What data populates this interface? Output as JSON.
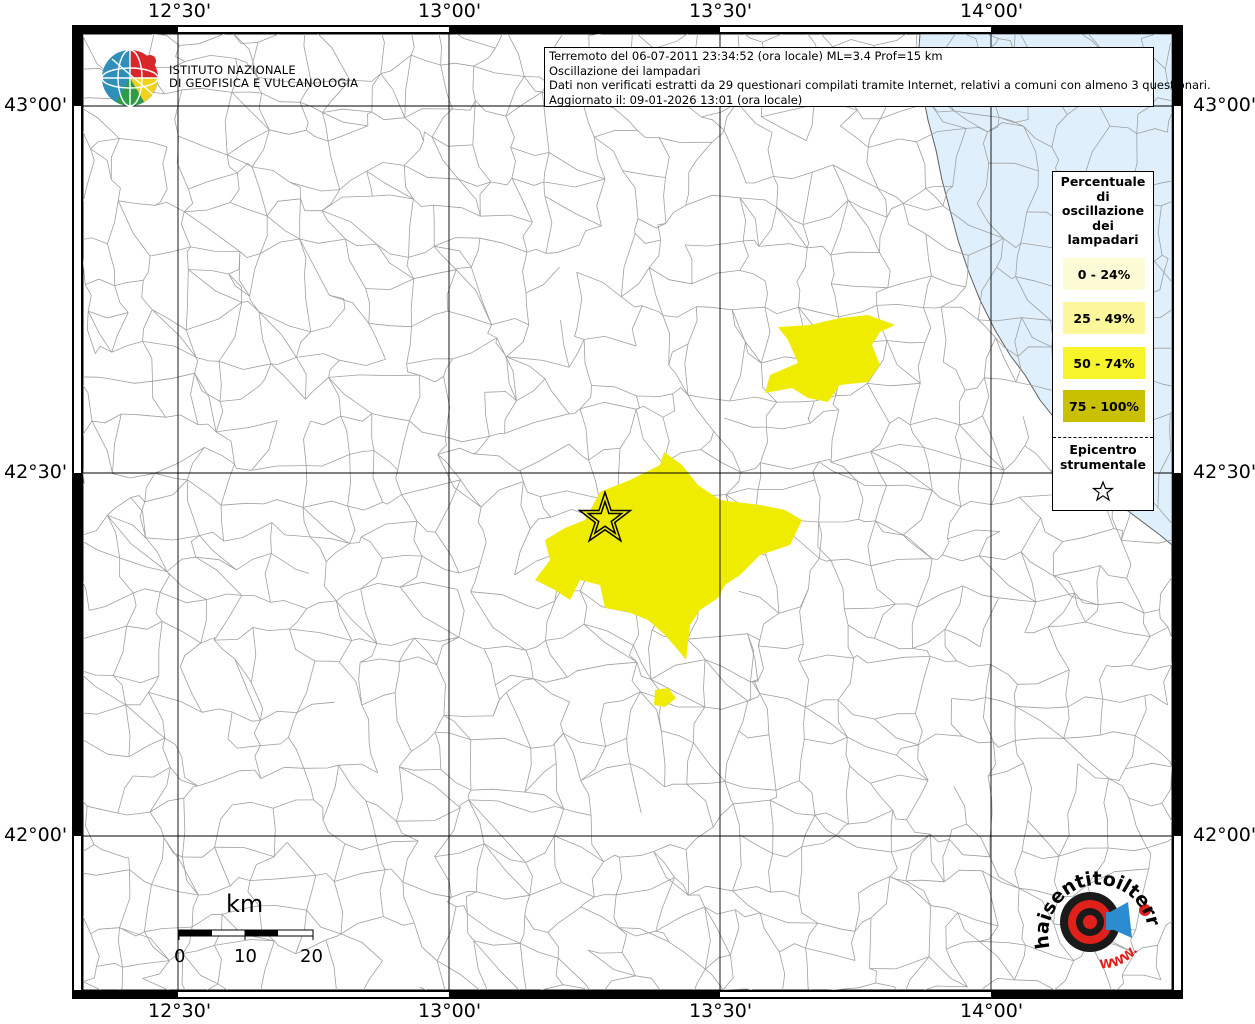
{
  "axes": {
    "top": [
      "12°30'",
      "13°00'",
      "13°30'",
      "14°00'"
    ],
    "bottom": [
      "12°30'",
      "13°00'",
      "13°30'",
      "14°00'"
    ],
    "left": [
      "43°00'",
      "42°30'",
      "42°00'"
    ],
    "right": [
      "43°00'",
      "42°30'",
      "42°00'"
    ]
  },
  "title_box": {
    "line1": "Terremoto del 06-07-2011 23:34:52 (ora locale) ML=3.4 Prof=15 km",
    "line2": "Oscillazione dei lampadari",
    "line3": "Dati non verificati estratti da 29 questionari compilati tramite Internet, relativi a comuni con almeno 3 questionari.",
    "line4": "Aggiornato il: 09-01-2026 13:01 (ora locale)"
  },
  "logo_ingv": {
    "line1": "ISTITUTO NAZIONALE",
    "line2": "DI GEOFISICA E VULCANOLOGIA",
    "icon": "globe-icon"
  },
  "legend": {
    "title_lines": [
      "Percentuale",
      "di",
      "oscillazione",
      "dei",
      "lampadari"
    ],
    "classes": [
      {
        "label": "0 - 24%",
        "color": "#fdfbd6"
      },
      {
        "label": "25 - 49%",
        "color": "#fbf79a"
      },
      {
        "label": "50 - 74%",
        "color": "#f7f42c"
      },
      {
        "label": "75 - 100%",
        "color": "#c9c002"
      }
    ],
    "epicenter_lines": [
      "Epicentro",
      "strumentale"
    ],
    "epicenter_icon": "star-icon"
  },
  "scale_bar": {
    "unit": "km",
    "ticks": [
      "0",
      "10",
      "20"
    ]
  },
  "logo_hsn": {
    "text_ring": "haisentitoilterremoto.it",
    "url_text": "WWW.",
    "icon": "target-megaphone-icon"
  },
  "colors": {
    "sea": "#dff0fc",
    "intensity_fill": "#efec00",
    "border": "#a0a0a0"
  }
}
